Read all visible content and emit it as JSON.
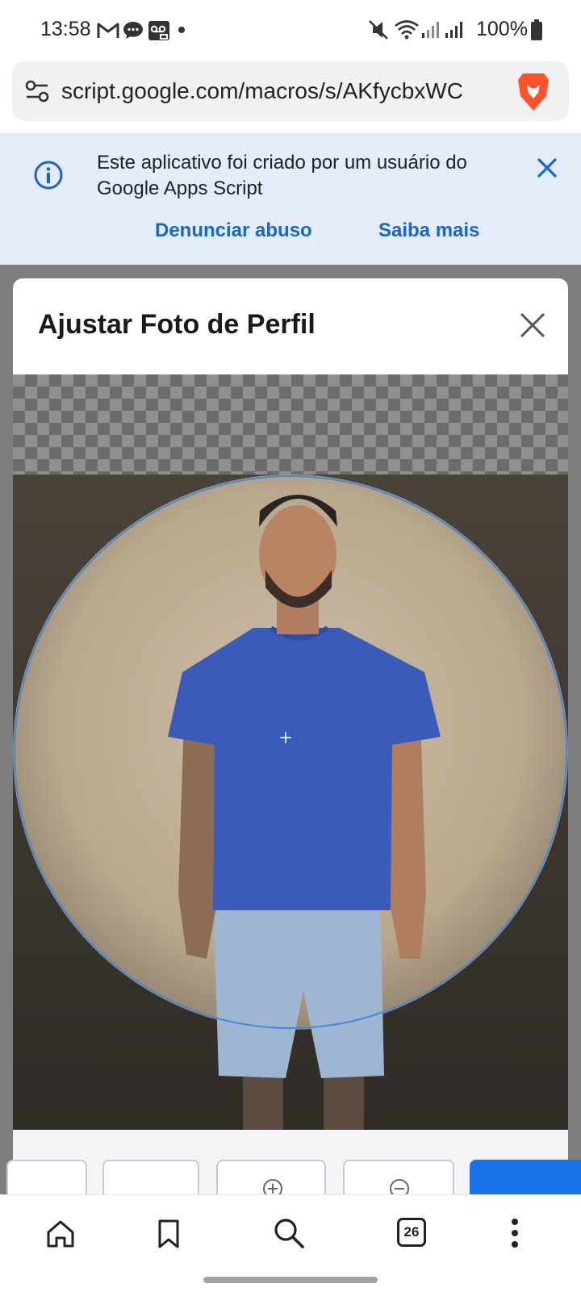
{
  "status_bar": {
    "time": "13:58",
    "battery_text": "100%",
    "notification_icons": [
      "gmail-icon",
      "chat-icon",
      "voicemail-icon",
      "dot-icon"
    ],
    "system_icons": [
      "mute-icon",
      "wifi-icon",
      "signal-icon",
      "signal-icon",
      "battery-icon"
    ]
  },
  "browser": {
    "url": "script.google.com/macros/s/AKfycbxWC",
    "site_settings_icon": "tune-icon",
    "brand_icon": "brave-lion-icon"
  },
  "banner": {
    "message": "Este aplicativo foi criado por um usuário do Google Apps Script",
    "report_link": "Denunciar abuso",
    "learn_link": "Saiba mais",
    "accent_color": "#1a66c8"
  },
  "dialog": {
    "title": "Ajustar Foto de Perfil",
    "buttons": [
      {
        "icon": "",
        "label": ""
      },
      {
        "icon": "",
        "label": ""
      },
      {
        "icon": "zoom-in-icon",
        "label": ""
      },
      {
        "icon": "zoom-out-icon",
        "label": ""
      },
      {
        "icon": "",
        "label": "",
        "style": "primary",
        "color": "#1a73e8"
      }
    ]
  },
  "bottom_nav": {
    "items": [
      "home-icon",
      "bookmark-icon",
      "search-icon",
      "tabs-icon",
      "menu-icon"
    ],
    "tab_count": "26"
  }
}
